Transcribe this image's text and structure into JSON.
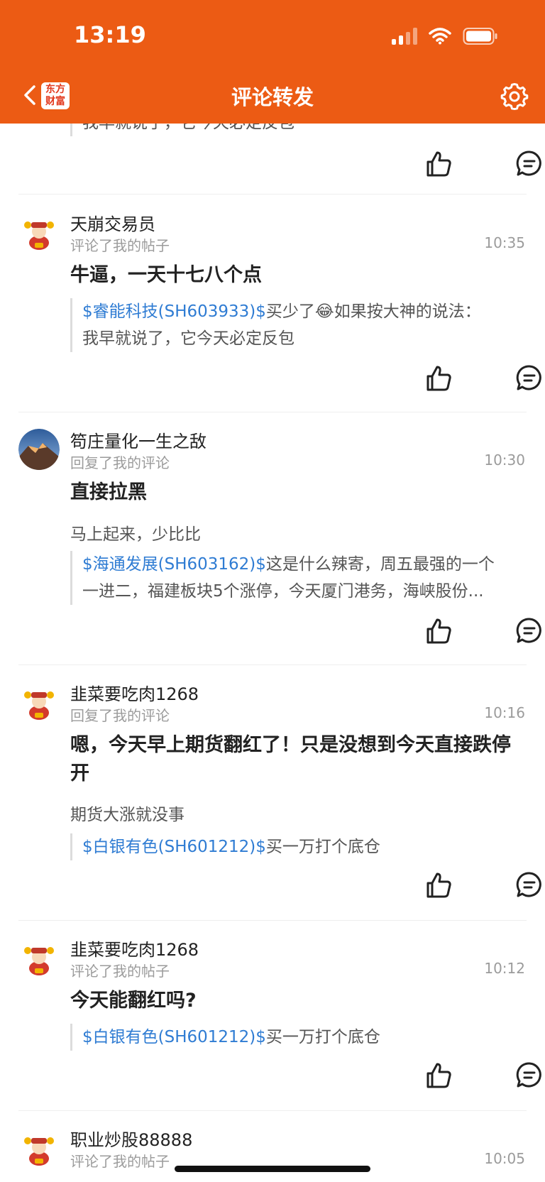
{
  "status_bar": {
    "time": "13:19"
  },
  "nav": {
    "title": "评论转发",
    "logo_line1": "东方",
    "logo_line2": "财富"
  },
  "top_fragment": {
    "quote_line2": "我早就说了，它今天必定反包"
  },
  "items": [
    {
      "user": "天崩交易员",
      "action": "评论了我的帖子",
      "time": "10:35",
      "main": "牛逼，一天十七八个点",
      "quote_stock": "$睿能科技(SH603933)$",
      "quote_text1": "买少了😂如果按大神的说法：",
      "quote_line2": "我早就说了，它今天必定反包"
    },
    {
      "user": "笱庄量化一生之敌",
      "action": "回复了我的评论",
      "time": "10:30",
      "main": "直接拉黑",
      "sub": "马上起来，少比比",
      "quote_stock": "$海通发展(SH603162)$",
      "quote_text1": "这是什么辣寄，周五最强的一个",
      "quote_line2": "一进二，福建板块5个涨停，今天厦门港务，海峡股份..."
    },
    {
      "user": "韭菜要吃肉1268",
      "action": "回复了我的评论",
      "time": "10:16",
      "main": "嗯，今天早上期货翻红了！只是没想到今天直接跌停开",
      "sub": "期货大涨就没事",
      "quote_stock": "$白银有色(SH601212)$",
      "quote_text1": "买一万打个底仓"
    },
    {
      "user": "韭菜要吃肉1268",
      "action": "评论了我的帖子",
      "time": "10:12",
      "main": "今天能翻红吗?",
      "quote_stock": "$白银有色(SH601212)$",
      "quote_text1": "买一万打个底仓"
    },
    {
      "user": "职业炒股88888",
      "action": "评论了我的帖子",
      "time": "10:05"
    }
  ]
}
